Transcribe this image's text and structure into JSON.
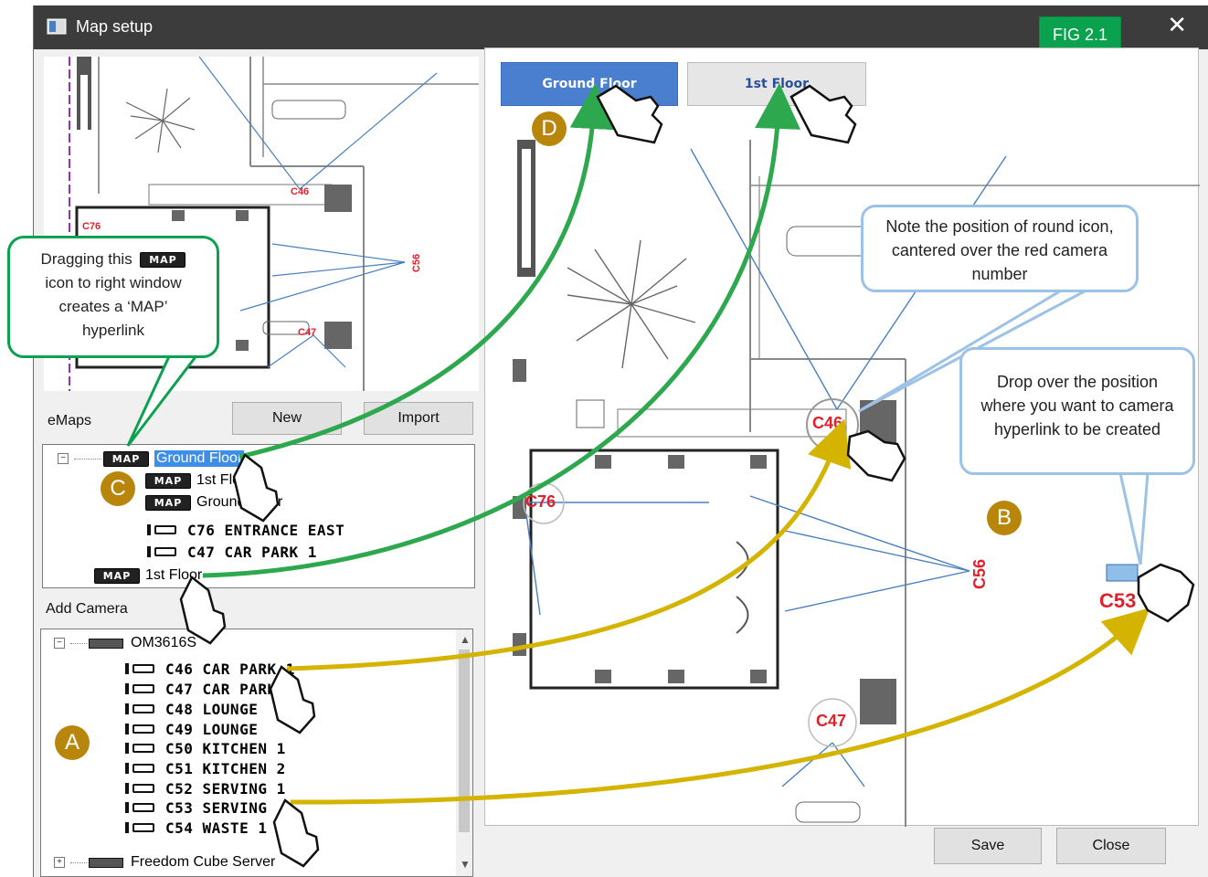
{
  "window": {
    "title": "Map setup",
    "close_glyph": "✕"
  },
  "fig_tag": "FIG 2.1",
  "emaps": {
    "label": "eMaps",
    "new_button": "New",
    "import_button": "Import",
    "map_badge": "MAP",
    "items": [
      {
        "label": "Ground Floor"
      },
      {
        "label": "1st Floor"
      },
      {
        "label": "Ground Floor"
      },
      {
        "label": "C76 ENTRANCE EAST"
      },
      {
        "label": "C47 CAR PARK 1"
      },
      {
        "label": "1st Floor"
      }
    ]
  },
  "add_camera": {
    "label": "Add Camera",
    "server": "OM3616S",
    "cameras": [
      "C46 CAR PARK 1",
      "C47 CAR PARK",
      "C48 LOUNGE",
      "C49 LOUNGE",
      "C50 KITCHEN 1",
      "C51 KITCHEN 2",
      "C52 SERVING 1",
      "C53 SERVING",
      "C54 WASTE 1"
    ],
    "server2": "Freedom Cube Server"
  },
  "floor_tabs": {
    "ground": "Ground Floor",
    "first": "1st Floor"
  },
  "map_labels": {
    "c46": "C46",
    "c76": "C76",
    "c56": "C56",
    "c47": "C47",
    "c53": "C53",
    "d_label": "D"
  },
  "thumb_labels": {
    "c46": "C46",
    "c76": "C76",
    "c56": "C56",
    "c47": "C47"
  },
  "callouts": {
    "green": "Dragging this MAP icon to right window creates a ‘MAP’ hyperlink",
    "green_line1": "Dragging this",
    "green_line2": "icon to right window",
    "green_line3": "creates a ‘MAP’",
    "green_line4": "hyperlink",
    "note": "Note the position of round icon, cantered over the red camera number",
    "drop": "Drop over the position where you want to camera hyperlink to be created"
  },
  "markers": {
    "a": "A",
    "b": "B",
    "c": "C",
    "d": "D"
  },
  "footer": {
    "save": "Save",
    "close": "Close"
  },
  "colors": {
    "green": "#0aa14f",
    "gold": "#b8860b",
    "callout_blue": "#9cc2e5",
    "arrow_yellow": "#d4b400",
    "arrow_green": "#2ea84f"
  }
}
